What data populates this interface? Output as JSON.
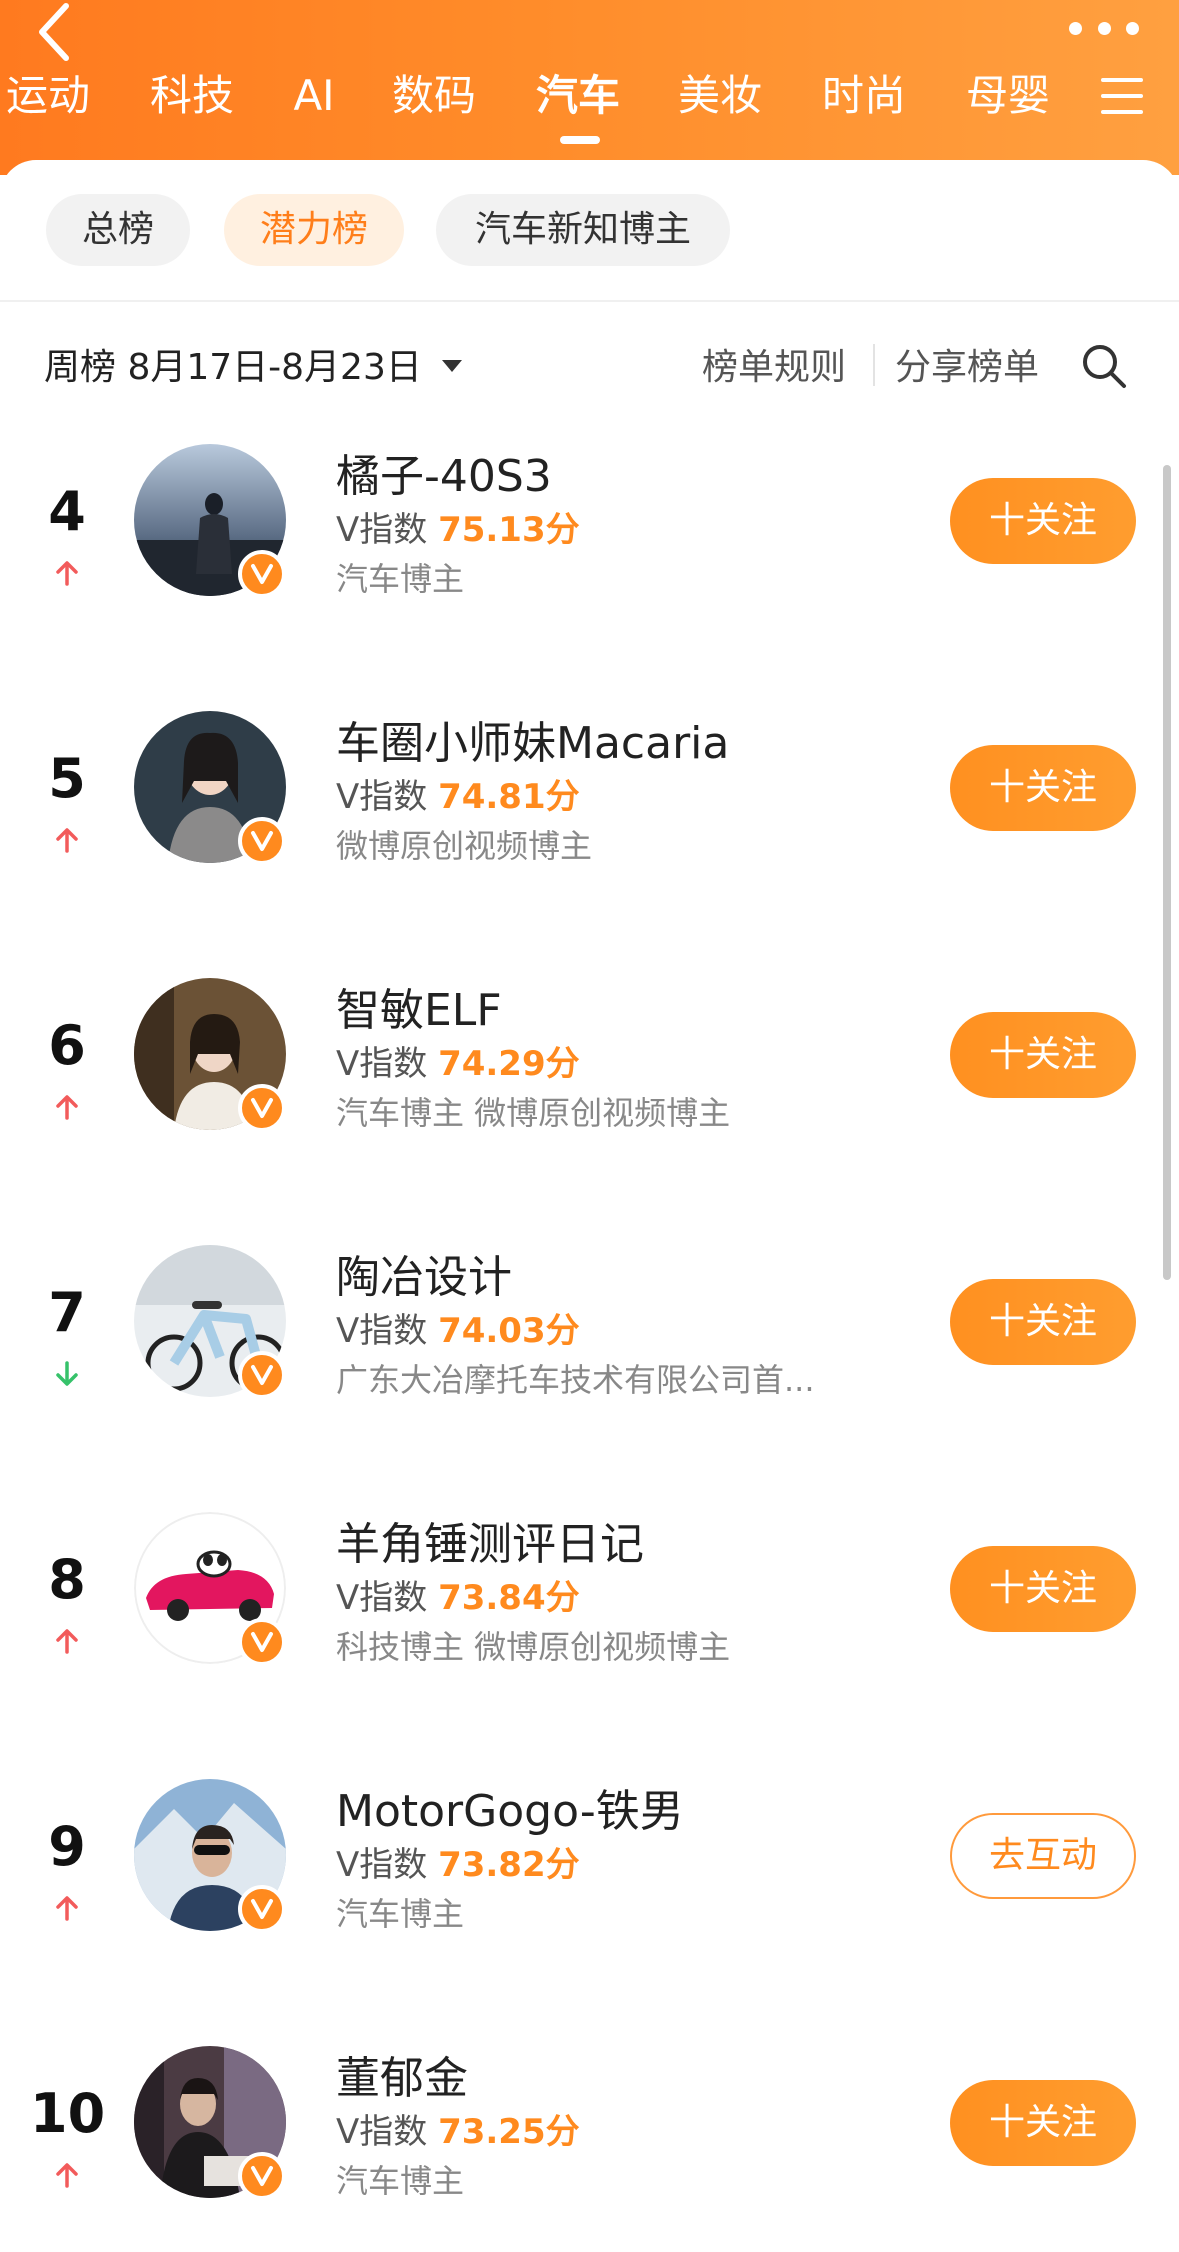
{
  "header": {
    "tabs": [
      {
        "label": "运动",
        "active": false
      },
      {
        "label": "科技",
        "active": false
      },
      {
        "label": "AI",
        "active": false
      },
      {
        "label": "数码",
        "active": false
      },
      {
        "label": "汽车",
        "active": true
      },
      {
        "label": "美妆",
        "active": false
      },
      {
        "label": "时尚",
        "active": false
      },
      {
        "label": "母婴",
        "active": false
      }
    ],
    "back_icon": "chevron-left-icon",
    "more_icon": "more-dots-icon",
    "menu_icon": "menu-icon"
  },
  "filters": {
    "chips": [
      {
        "label": "总榜",
        "active": false
      },
      {
        "label": "潜力榜",
        "active": true
      },
      {
        "label": "汽车新知博主",
        "active": false
      }
    ]
  },
  "period": {
    "label": "周榜 8月17日-8月23日",
    "rules_label": "榜单规则",
    "share_label": "分享榜单"
  },
  "list": [
    {
      "rank": "4",
      "trend": "up",
      "name": "橘子-40S3",
      "vindex_label": "V指数 ",
      "score": "75.13分",
      "tags": "汽车博主",
      "button": "十关注"
    },
    {
      "rank": "5",
      "trend": "up",
      "name": "车圈小师妹Macaria",
      "vindex_label": "V指数 ",
      "score": "74.81分",
      "tags": "微博原创视频博主",
      "button": "十关注"
    },
    {
      "rank": "6",
      "trend": "up",
      "name": "智敏ELF",
      "vindex_label": "V指数 ",
      "score": "74.29分",
      "tags": "汽车博主 微博原创视频博主",
      "button": "十关注"
    },
    {
      "rank": "7",
      "trend": "down",
      "name": "陶冶设计",
      "vindex_label": "V指数 ",
      "score": "74.03分",
      "tags": "广东大冶摩托车技术有限公司首...",
      "button": "十关注"
    },
    {
      "rank": "8",
      "trend": "up",
      "name": "羊角锤测评日记",
      "vindex_label": "V指数 ",
      "score": "73.84分",
      "tags": "科技博主 微博原创视频博主",
      "button": "十关注"
    },
    {
      "rank": "9",
      "trend": "up",
      "name": "MotorGogo-铁男",
      "vindex_label": "V指数 ",
      "score": "73.82分",
      "tags": "汽车博主",
      "button": "去互动"
    },
    {
      "rank": "10",
      "trend": "up",
      "name": "董郁金",
      "vindex_label": "V指数 ",
      "score": "73.25分",
      "tags": "汽车博主",
      "button": "十关注"
    }
  ],
  "colors": {
    "accent": "#ff8a1e",
    "up": "#f25b5b",
    "down": "#36c26a"
  }
}
